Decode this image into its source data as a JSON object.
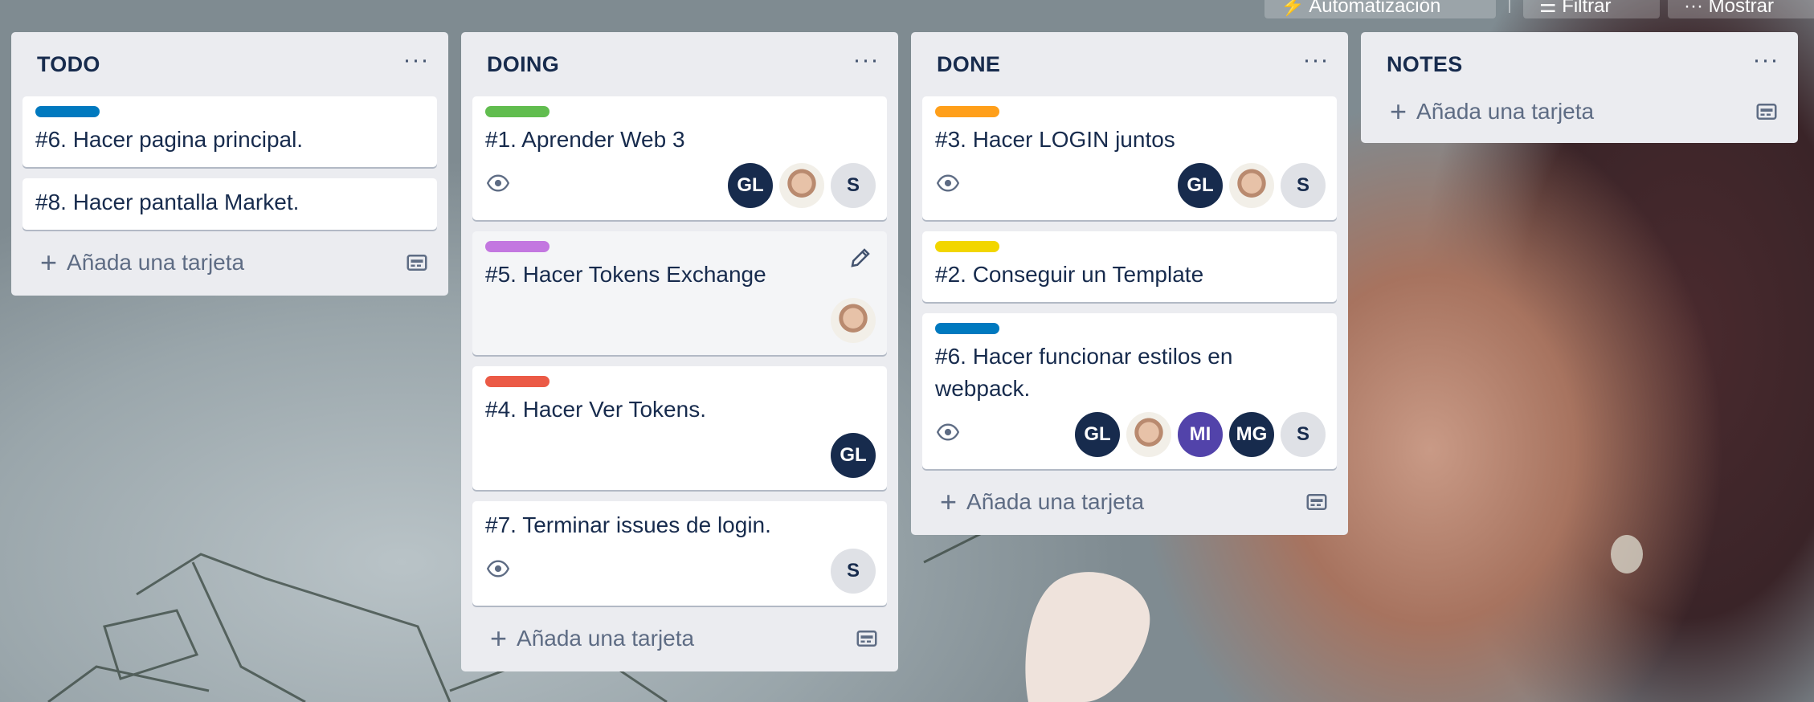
{
  "colors": {
    "blue": "#0079bf",
    "green": "#61bd4f",
    "purple": "#c377e0",
    "red": "#eb5a46",
    "orange": "#ff9f1a",
    "yellow": "#f2d600"
  },
  "toolbar": {
    "automation_label": "Automatización",
    "filter_label": "Filtrar",
    "show_label": "Mostrar"
  },
  "add_card_label": "Añada una tarjeta",
  "lists": [
    {
      "title": "TODO",
      "menu": "···",
      "cards": [
        {
          "label": "blue",
          "title": "#6. Hacer pagina principal."
        },
        {
          "title": "#8. Hacer pantalla Market."
        }
      ]
    },
    {
      "title": "DOING",
      "menu": "···",
      "cards": [
        {
          "label": "green",
          "title": "#1. Aprender Web 3",
          "watch": true,
          "members": [
            "GL",
            "photo",
            "S"
          ]
        },
        {
          "label": "purple",
          "title": "#5. Hacer Tokens Exchange",
          "members": [
            "photo"
          ],
          "edit_icon": "pencil-icon"
        },
        {
          "label": "red",
          "title": "#4. Hacer Ver Tokens.",
          "members": [
            "GL"
          ]
        },
        {
          "title": "#7. Terminar issues de login.",
          "watch": true,
          "members": [
            "S"
          ]
        }
      ]
    },
    {
      "title": "DONE",
      "menu": "···",
      "cards": [
        {
          "label": "orange",
          "title": "#3. Hacer LOGIN juntos",
          "watch": true,
          "members": [
            "GL",
            "photo",
            "S"
          ]
        },
        {
          "label": "yellow",
          "title": "#2. Conseguir un Template"
        },
        {
          "label": "blue",
          "title": "#6. Hacer funcionar estilos en webpack.",
          "watch": true,
          "members": [
            "GL",
            "photo",
            "MI",
            "MG",
            "S"
          ]
        }
      ]
    },
    {
      "title": "NOTES",
      "menu": "···",
      "cards": []
    }
  ]
}
